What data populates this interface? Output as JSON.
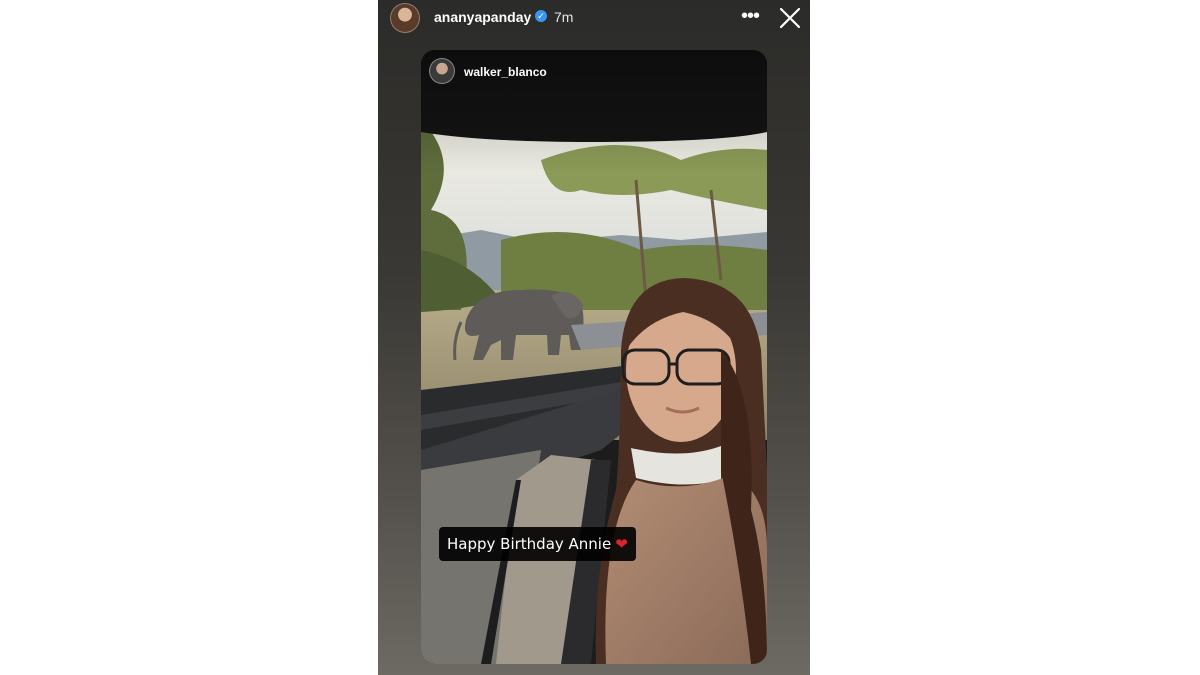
{
  "story": {
    "username": "ananyapanday",
    "time": "7m",
    "more_label": "•••",
    "verified_glyph": "✓"
  },
  "shared_post": {
    "username": "walker_blanco",
    "caption": "Happy Birthday Annie",
    "heart": "❤"
  },
  "icons": {
    "profile": "avatar",
    "verified": "verified-badge-icon",
    "more": "more-options-icon",
    "close": "close-icon"
  },
  "colors": {
    "accent": "#3897f0",
    "heart": "#e0242e"
  }
}
